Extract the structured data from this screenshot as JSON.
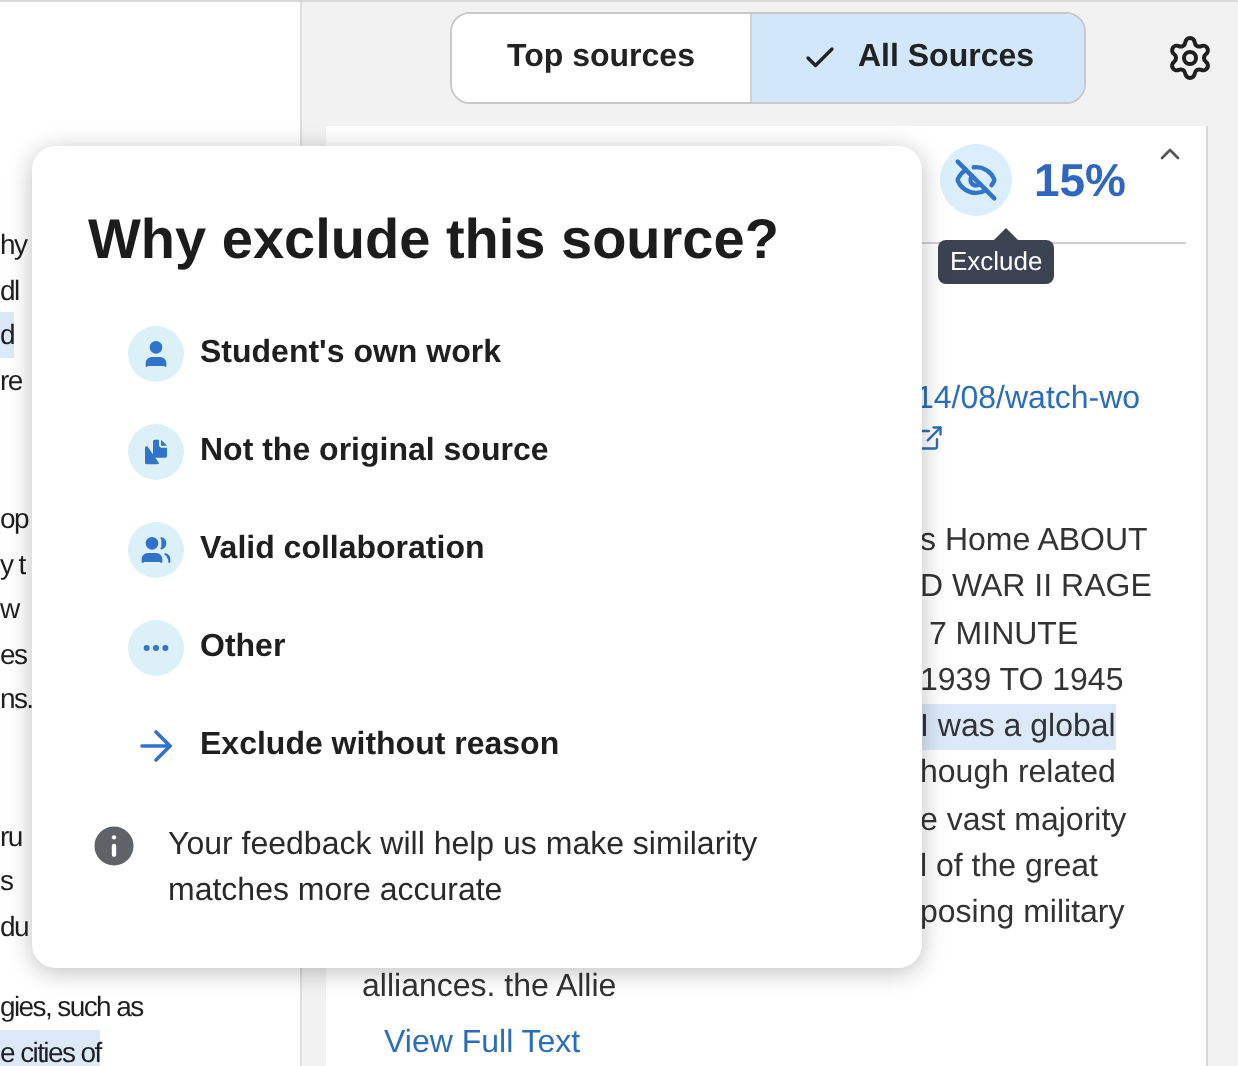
{
  "view_toggle": [
    {
      "label": "Top sources",
      "selected": false
    },
    {
      "label": "All Sources",
      "selected": true
    }
  ],
  "document_paragraphs": [
    [
      {
        "text": "hy",
        "highlighted": false
      },
      {
        "text": "dl",
        "highlighted": false
      },
      {
        "text": "d",
        "highlighted": true
      },
      {
        "text": "re",
        "highlighted": false
      }
    ],
    [
      {
        "text": "op",
        "highlighted": false
      },
      {
        "text": "y t",
        "highlighted": false
      },
      {
        "text": "w",
        "highlighted": false
      },
      {
        "text": "es",
        "highlighted": false
      },
      {
        "text": "ns.",
        "highlighted": false
      }
    ],
    [
      {
        "text": "ru",
        "highlighted": false
      },
      {
        "text": "s",
        "highlighted": false
      },
      {
        "text": "du",
        "highlighted": false
      }
    ],
    [
      {
        "text": "gies, such as",
        "highlighted": false
      },
      {
        "text": "e cities of",
        "highlighted": true
      }
    ]
  ],
  "source_card": {
    "percent": "15%",
    "tooltip": "Exclude",
    "link": "14/08/watch-wo",
    "excerpt_lines": [
      {
        "text": "s Home ABOUT",
        "highlighted": false
      },
      {
        "text": "D WAR II RAGE",
        "highlighted": false
      },
      {
        "text": " 7 MINUTE",
        "highlighted": false
      },
      {
        "text": "1939 TO 1945",
        "highlighted": false
      },
      {
        "text": "I was a global",
        "highlighted": true
      },
      {
        "text": "hough related",
        "highlighted": false
      },
      {
        "text": "e vast majority",
        "highlighted": false
      },
      {
        "text": "l of the great",
        "highlighted": false
      },
      {
        "text": "posing military",
        "highlighted": false
      }
    ],
    "last_line": "alliances. the Allie",
    "view_full_text": "View Full Text"
  },
  "exclude_dialog": {
    "title": "Why exclude this source?",
    "options": [
      {
        "kind": "person",
        "label": "Student's own work"
      },
      {
        "kind": "copy",
        "label": "Not the original source"
      },
      {
        "kind": "group",
        "label": "Valid collaboration"
      },
      {
        "kind": "more",
        "label": "Other"
      },
      {
        "kind": "arrow",
        "label": "Exclude without reason"
      }
    ],
    "note": "Your feedback will help us make similarity matches more accurate"
  }
}
